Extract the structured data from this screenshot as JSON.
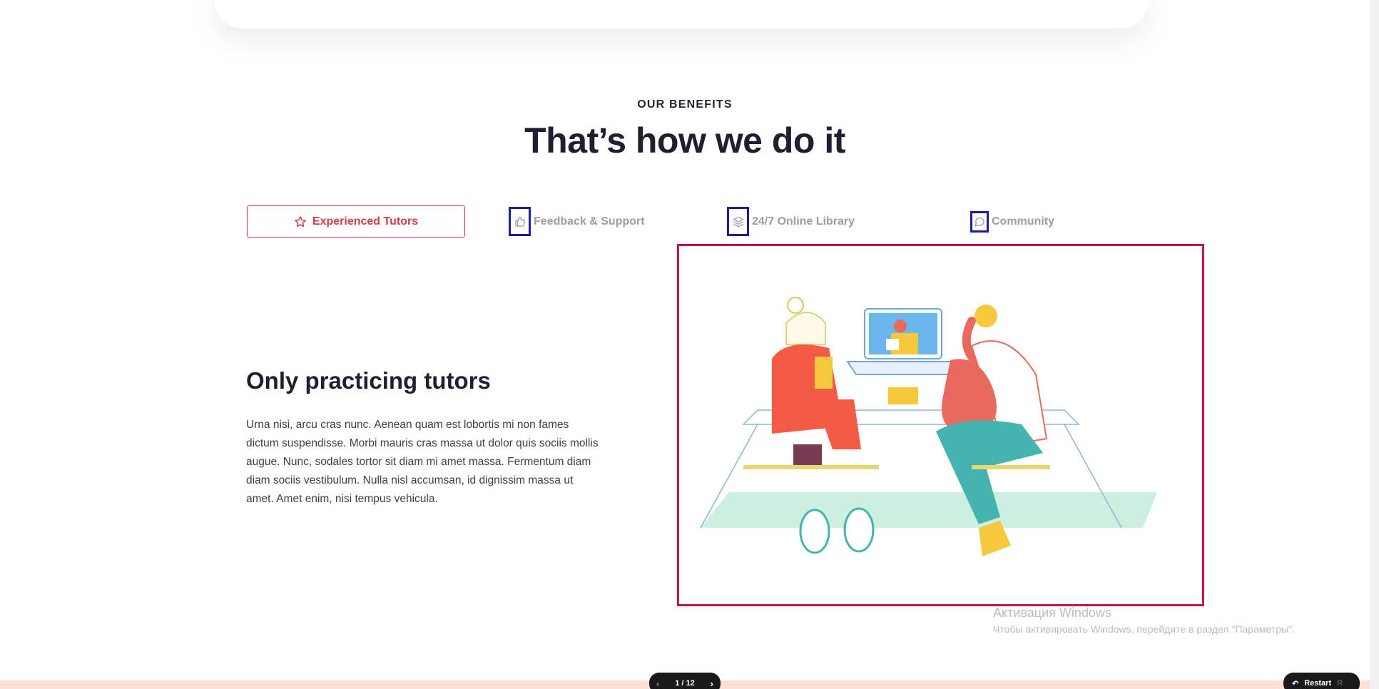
{
  "benefits": {
    "eyebrow": "OUR BENEFITS",
    "title": "That’s how we do it"
  },
  "tabs": [
    {
      "label": "Experienced Tutors",
      "icon": "star-icon",
      "active": true
    },
    {
      "label": "Feedback & Support",
      "icon": "thumbs-up-icon",
      "active": false
    },
    {
      "label": "24/7 Online Library",
      "icon": "layers-icon",
      "active": false
    },
    {
      "label": "Community",
      "icon": "chat-bubble-icon",
      "active": false
    }
  ],
  "content": {
    "title": "Only practicing tutors",
    "body": "Urna nisi, arcu cras nunc. Aenean quam est lobortis mi non fames dictum suspendisse. Morbi mauris cras massa ut dolor quis sociis mollis augue. Nunc, sodales tortor sit diam mi amet massa. Fermentum diam diam sociis vestibulum. Nulla nisl accumsan, id dignissim massa ut amet. Amet enim, nisi tempus vehicula."
  },
  "watermark": {
    "line1": "Активация Windows",
    "line2": "Чтобы активировать Windows, перейдите в раздел \"Параметры\"."
  },
  "controls": {
    "pager": "1 / 12",
    "restart_label": "Restart",
    "restart_key": "R"
  },
  "colors": {
    "accent": "#d43d46",
    "annotation_blue": "#1b1f9c",
    "annotation_red": "#c4164a"
  }
}
